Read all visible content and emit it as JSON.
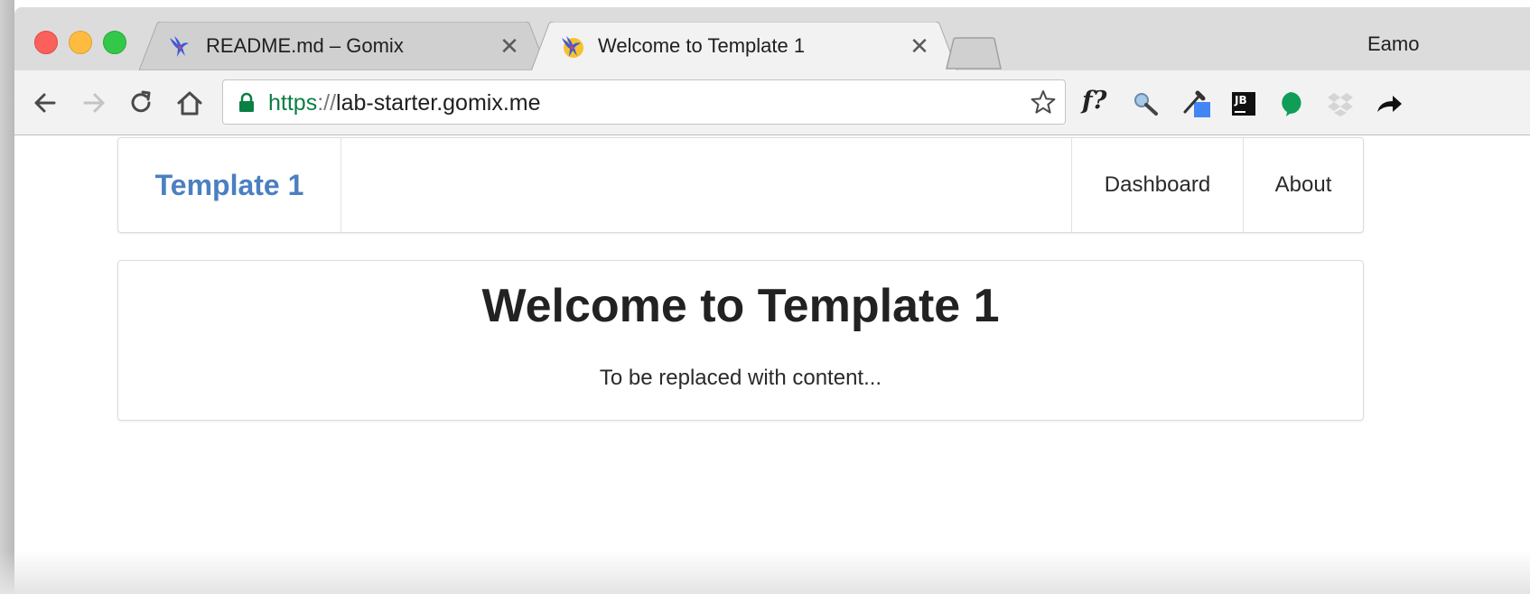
{
  "browser": {
    "tabs": [
      {
        "title": "README.md – Gomix",
        "active": false,
        "close": "✕"
      },
      {
        "title": "Welcome to Template 1",
        "active": true,
        "close": "✕"
      }
    ],
    "profile_name": "Eamo",
    "url": {
      "scheme": "https",
      "separator": "://",
      "host": "lab-starter.gomix.me"
    },
    "extensions": [
      "fquery-icon",
      "magnifier-icon",
      "eyedropper-icon",
      "jetbrains-icon",
      "chat-bubble-icon",
      "dropbox-icon",
      "share-arrow-icon"
    ],
    "extension_labels": {
      "fquery": "f?",
      "jetbrains": "JB"
    }
  },
  "site": {
    "brand": "Template 1",
    "nav": [
      {
        "label": "Dashboard"
      },
      {
        "label": "About"
      }
    ],
    "heading": "Welcome to Template 1",
    "body_text": "To be replaced with content..."
  },
  "colors": {
    "brand": "#4a80c1",
    "secure_green": "#0b8043",
    "chat_green": "#0f9d58",
    "eyedropper_blue": "#4285f4"
  }
}
